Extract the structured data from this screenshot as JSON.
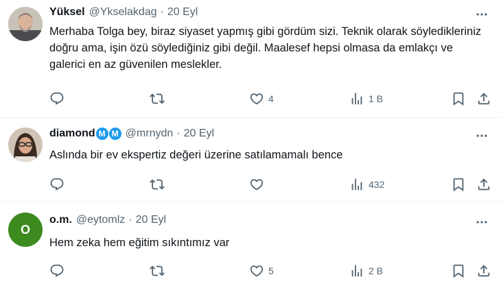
{
  "tweets": [
    {
      "name": "Yüksel",
      "handle": "@Ykselakdag",
      "dot": "·",
      "date": "20 Eyl",
      "text": "Merhaba Tolga bey, biraz siyaset yapmış gibi gördüm sizi. Teknik olarak söyledikleriniz doğru ama, işin özü söylediğiniz gibi değil. Maalesef hepsi olmasa da emlakçı ve galerici en az güvenilen meslekler.",
      "likes": "4",
      "views": "1 B"
    },
    {
      "name": "diamond",
      "badges": [
        "M",
        "M"
      ],
      "handle": "@mrnydn",
      "dot": "·",
      "date": "20 Eyl",
      "text": "Aslında bir ev ekspertiz değeri üzerine satılamamalı bence",
      "likes": "",
      "views": "432"
    },
    {
      "name": "o.m.",
      "avatar_letter": "O",
      "avatar_color": "#3d8b1f",
      "handle": "@eytomlz",
      "dot": "·",
      "date": "20 Eyl",
      "text": "Hem zeka hem eğitim sıkıntımız var",
      "likes": "5",
      "views": "2 B"
    }
  ],
  "icons": [
    "more-icon",
    "reply-icon",
    "retweet-icon",
    "like-icon",
    "views-icon",
    "bookmark-icon",
    "share-icon"
  ],
  "colors": {
    "text": "#0f1419",
    "secondary": "#536471",
    "verified_blue": "#1d9bf0",
    "divider": "#eff3f4"
  }
}
